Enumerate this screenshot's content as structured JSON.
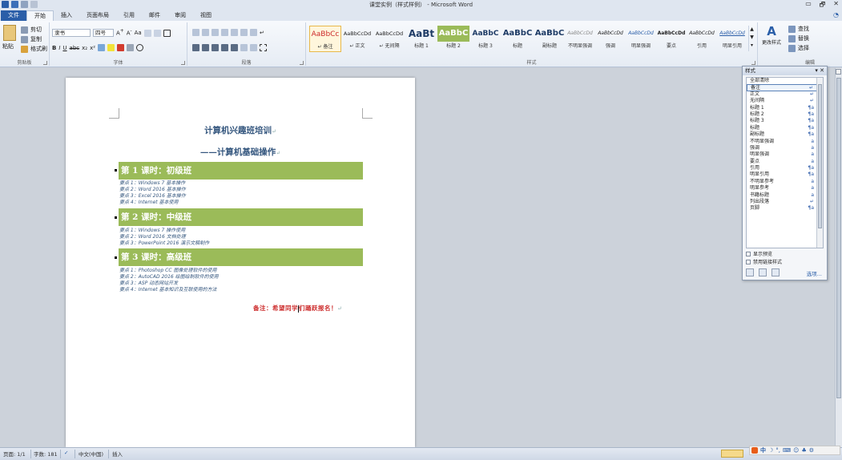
{
  "window": {
    "title": "课堂实例（样式样例） - Microsoft Word",
    "controls": [
      "▭",
      "🗗",
      "✕"
    ]
  },
  "tabs": [
    {
      "label": "文件"
    },
    {
      "label": "开始"
    },
    {
      "label": "插入"
    },
    {
      "label": "页面布局"
    },
    {
      "label": "引用"
    },
    {
      "label": "邮件"
    },
    {
      "label": "审阅"
    },
    {
      "label": "视图"
    }
  ],
  "ribbon": {
    "clipboard": {
      "paste": "粘贴",
      "cut": "剪切",
      "copy": "复制",
      "format_painter": "格式刷",
      "label": "剪贴板"
    },
    "font": {
      "name": "隶书",
      "size": "四号",
      "label": "字体"
    },
    "paragraph": {
      "label": "段落"
    },
    "styles": {
      "label": "样式",
      "items": [
        {
          "sample": "AaBbCc",
          "name": "↵ 备注"
        },
        {
          "sample": "AaBbCcDd",
          "name": "↵ 正文"
        },
        {
          "sample": "AaBbCcDd",
          "name": "↵ 无间隔"
        },
        {
          "sample": "AaBt",
          "name": "标题 1"
        },
        {
          "sample": "AaBbC",
          "name": "标题 2"
        },
        {
          "sample": "AaBbC",
          "name": "标题 3"
        },
        {
          "sample": "AaBbC",
          "name": "标题"
        },
        {
          "sample": "AaBbC",
          "name": "副标题"
        },
        {
          "sample": "AaBbCcDd",
          "name": "不明显强调"
        },
        {
          "sample": "AaBbCcDd",
          "name": "强调"
        },
        {
          "sample": "AaBbCcDd",
          "name": "明显强调"
        },
        {
          "sample": "AaBbCcDd",
          "name": "要点"
        },
        {
          "sample": "AaBbCcDd",
          "name": "引用"
        },
        {
          "sample": "AaBbCcDd",
          "name": "明显引用"
        }
      ],
      "change_styles": "更改样式"
    },
    "editing": {
      "find": "查找",
      "replace": "替换",
      "select": "选择",
      "label": "编辑"
    }
  },
  "document": {
    "title": "计算机兴趣班培训",
    "subtitle": "——计算机基础操作",
    "lessons": [
      {
        "heading": "第 1 课时：初级班",
        "topics": [
          "要点 1：Windows 7 基本操作",
          "要点 2：Word 2016 基本操作",
          "要点 3：Excel 2016 基本操作",
          "要点 4：Internet 基本使用"
        ]
      },
      {
        "heading": "第 2 课时：中级班",
        "topics": [
          "要点 1：Windows 7 操作使用",
          "要点 2：Word 2016 文档处理",
          "要点 3：PowerPoint 2016 演示文稿制作"
        ]
      },
      {
        "heading": "第 3 课时：高级班",
        "topics": [
          "要点 1：Photoshop CC 图像处理软件的使用",
          "要点 2：AutoCAD 2016 绘图绘制软件的使用",
          "要点 3：ASP 动态网站开发",
          "要点 4：Internet 基本知识及互联使用的方法"
        ]
      }
    ],
    "remark_before_cursor": "备注：希望同学",
    "remark_after_cursor": "们踊跃报名！"
  },
  "styles_pane": {
    "title": "样式",
    "items": [
      {
        "name": "全部清除",
        "mark": ""
      },
      {
        "name": "备注",
        "mark": "↵"
      },
      {
        "name": "正文",
        "mark": "↵"
      },
      {
        "name": "无间隔",
        "mark": "↵"
      },
      {
        "name": "标题 1",
        "mark": "¶a"
      },
      {
        "name": "标题 2",
        "mark": "¶a"
      },
      {
        "name": "标题 3",
        "mark": "¶a"
      },
      {
        "name": "标题",
        "mark": "¶a"
      },
      {
        "name": "副标题",
        "mark": "¶a"
      },
      {
        "name": "不明显强调",
        "mark": "a"
      },
      {
        "name": "强调",
        "mark": "a"
      },
      {
        "name": "明显强调",
        "mark": "a"
      },
      {
        "name": "要点",
        "mark": "a"
      },
      {
        "name": "引用",
        "mark": "¶a"
      },
      {
        "name": "明显引用",
        "mark": "¶a"
      },
      {
        "name": "不明显参考",
        "mark": "a"
      },
      {
        "name": "明显参考",
        "mark": "a"
      },
      {
        "name": "书籍标题",
        "mark": "a"
      },
      {
        "name": "列出段落",
        "mark": "↵"
      },
      {
        "name": "页脚",
        "mark": "¶a"
      }
    ],
    "show_preview": "显示预览",
    "disable_linked": "禁用链接样式",
    "options": "选项..."
  },
  "statusbar": {
    "page": "页面: 1/1",
    "words": "字数: 181",
    "language": "中文(中国)",
    "mode": "插入"
  },
  "ime": {
    "label": "中"
  },
  "colors": {
    "accent": "#2a5ea8",
    "lesson_bar": "#9bbb59",
    "remark": "#cc2a2a",
    "heading": "#34567e"
  }
}
